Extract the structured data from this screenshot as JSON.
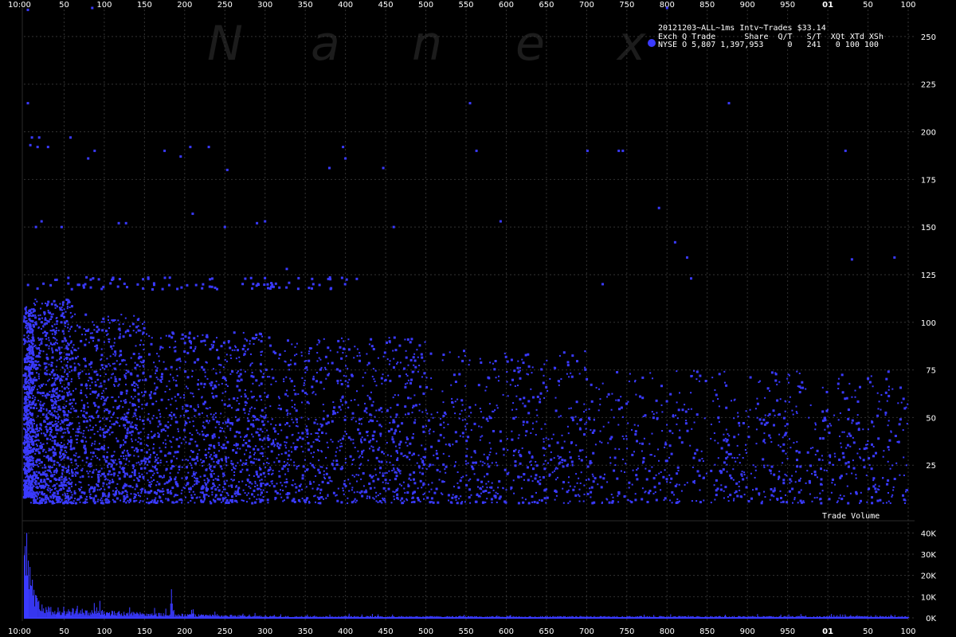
{
  "chart_data": {
    "type": "scatter",
    "watermark": [
      "N",
      "a",
      "n",
      "e",
      "x"
    ],
    "legend": {
      "title": "20121203~ALL~1ms Intv~Trades $33.14",
      "header": "Exch Q Trade      Share  Q/T   S/T  XQt XTd XSh",
      "row": "NYSE O 5,807 1,397,953     0   241   0 100 100",
      "marker_color": "#3a3aff"
    },
    "x_axis": {
      "start_label": "10:00",
      "tick_labels": [
        "50",
        "100",
        "150",
        "200",
        "250",
        "300",
        "350",
        "400",
        "450",
        "500",
        "550",
        "600",
        "650",
        "700",
        "750",
        "800",
        "850",
        "900",
        "950",
        "01",
        "50",
        "100"
      ],
      "bold_label": "01",
      "range_ms": [
        0,
        1100
      ]
    },
    "y_axis_top": {
      "tick_labels": [
        "25",
        "50",
        "75",
        "100",
        "125",
        "150",
        "175",
        "200",
        "225",
        "250"
      ],
      "range": [
        0,
        265
      ]
    },
    "y_axis_bottom": {
      "label": "Trade Volume",
      "tick_labels": [
        "0K",
        "10K",
        "20K",
        "30K",
        "40K"
      ],
      "range": [
        0,
        45000
      ]
    },
    "series": [
      {
        "name": "NYSE",
        "color": "#3a3aff",
        "clusters": [
          {
            "x": [
              0,
              12
            ],
            "y": [
              8,
              108
            ],
            "count": 700
          },
          {
            "x": [
              12,
              60
            ],
            "y": [
              5,
              112
            ],
            "count": 900
          },
          {
            "x": [
              60,
              150
            ],
            "y": [
              5,
              105
            ],
            "count": 800
          },
          {
            "x": [
              150,
              300
            ],
            "y": [
              5,
              95
            ],
            "count": 900
          },
          {
            "x": [
              300,
              500
            ],
            "y": [
              5,
              92
            ],
            "count": 750
          },
          {
            "x": [
              500,
              700
            ],
            "y": [
              5,
              85
            ],
            "count": 420
          },
          {
            "x": [
              700,
              900
            ],
            "y": [
              5,
              75
            ],
            "count": 280
          },
          {
            "x": [
              900,
              1100
            ],
            "y": [
              5,
              75
            ],
            "count": 320
          },
          {
            "x": [
              0,
              1100
            ],
            "y": [
              5,
              55
            ],
            "count": 600
          }
        ],
        "outliers": [
          [
            5,
            215
          ],
          [
            8,
            193
          ],
          [
            10,
            197
          ],
          [
            17,
            192
          ],
          [
            19,
            197
          ],
          [
            30,
            192
          ],
          [
            58,
            197
          ],
          [
            88,
            190
          ],
          [
            80,
            186
          ],
          [
            175,
            190
          ],
          [
            195,
            187
          ],
          [
            207,
            192
          ],
          [
            230,
            192
          ],
          [
            253,
            180
          ],
          [
            380,
            181
          ],
          [
            397,
            192
          ],
          [
            400,
            186
          ],
          [
            447,
            181
          ],
          [
            563,
            190
          ],
          [
            555,
            215
          ],
          [
            593,
            153
          ],
          [
            701,
            190
          ],
          [
            740,
            190
          ],
          [
            745,
            190
          ],
          [
            877,
            215
          ],
          [
            1022,
            190
          ],
          [
            1083,
            134
          ],
          [
            15,
            150
          ],
          [
            22,
            153
          ],
          [
            47,
            150
          ],
          [
            118,
            152
          ],
          [
            127,
            152
          ],
          [
            210,
            157
          ],
          [
            250,
            150
          ],
          [
            290,
            152
          ],
          [
            327,
            128
          ],
          [
            300,
            153
          ],
          [
            360,
            120
          ],
          [
            460,
            150
          ],
          [
            810,
            142
          ],
          [
            825,
            134
          ],
          [
            1030,
            133
          ],
          [
            830,
            123
          ],
          [
            720,
            120
          ],
          [
            790,
            160
          ],
          [
            800,
            265
          ],
          [
            5,
            264
          ],
          [
            85,
            265
          ]
        ],
        "rows_near": [
          120,
          123,
          118
        ]
      }
    ],
    "volume_series": {
      "name": "Trade Volume",
      "color": "#3a3aff",
      "spikes": [
        [
          3,
          40000
        ],
        [
          5,
          27000
        ],
        [
          7,
          24000
        ],
        [
          10,
          18000
        ],
        [
          14,
          12000
        ],
        [
          18,
          9000
        ],
        [
          22,
          7000
        ],
        [
          30,
          6000
        ],
        [
          42,
          5500
        ],
        [
          55,
          4500
        ],
        [
          70,
          4000
        ],
        [
          90,
          3500
        ],
        [
          110,
          3000
        ],
        [
          140,
          2500
        ],
        [
          170,
          2200
        ],
        [
          183,
          15000
        ],
        [
          200,
          2000
        ],
        [
          210,
          4500
        ],
        [
          240,
          2000
        ],
        [
          280,
          1800
        ],
        [
          300,
          1500
        ]
      ]
    }
  }
}
